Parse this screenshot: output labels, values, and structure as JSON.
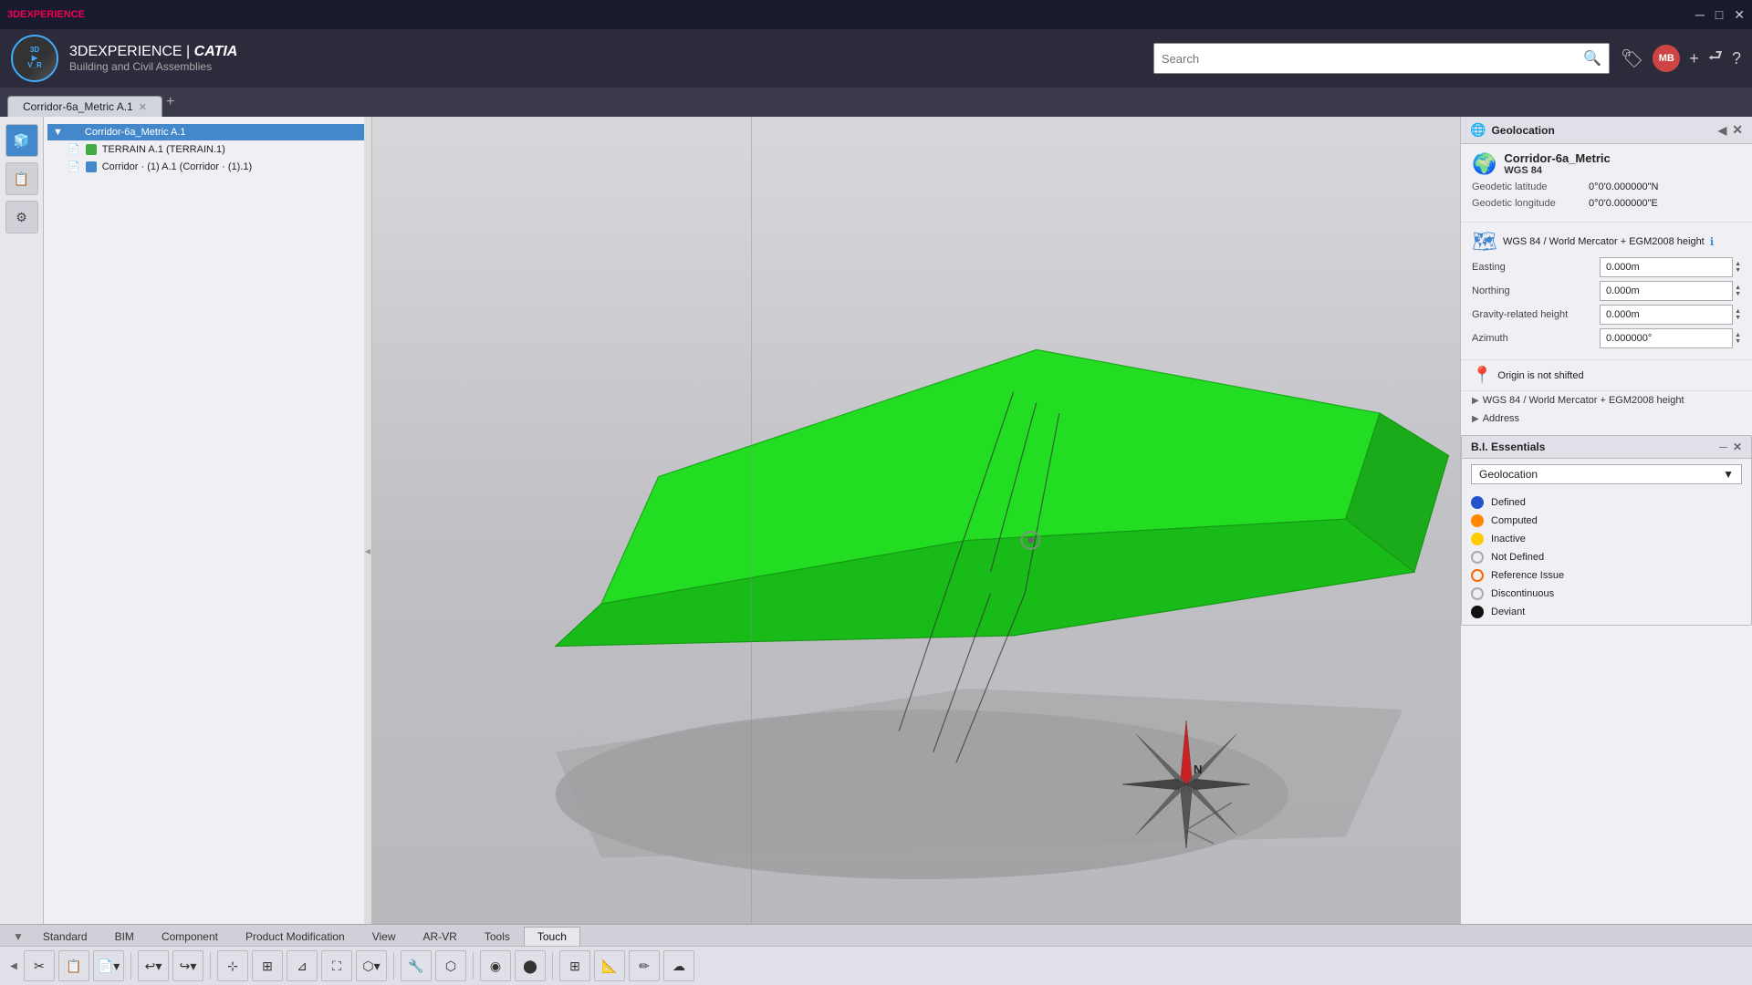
{
  "titlebar": {
    "app_name": "3DEXPERIENCE",
    "min_btn": "─",
    "max_btn": "□",
    "close_btn": "✕"
  },
  "header": {
    "logo_text": "3D\n▶\nV_R",
    "app_prefix": "3DEXPERIENCE",
    "separator": "|",
    "app_name": "CATIA",
    "app_subtitle": "Building and Civil Assemblies",
    "search_placeholder": "Search",
    "user_initials": "MB"
  },
  "tabs": [
    {
      "label": "Corridor-6a_Metric A.1",
      "active": true
    }
  ],
  "tree": {
    "items": [
      {
        "label": "Corridor-6a_Metric A.1",
        "level": 0,
        "selected": true,
        "color": "#4488cc"
      },
      {
        "label": "TERRAIN A.1 (TERRAIN.1)",
        "level": 1,
        "selected": false,
        "color": "#44aa44"
      },
      {
        "label": "Corridor · (1) A.1 (Corridor · (1).1)",
        "level": 1,
        "selected": false,
        "color": "#4488cc"
      }
    ]
  },
  "geolocation_panel": {
    "title": "Geolocation",
    "model_name": "Corridor-6a_Metric",
    "wgs84_label": "WGS 84",
    "geodetic_latitude_label": "Geodetic latitude",
    "geodetic_latitude_value": "0°0'0.000000\"N",
    "geodetic_longitude_label": "Geodetic longitude",
    "geodetic_longitude_value": "0°0'0.000000\"E",
    "crs_title": "WGS 84 / World Mercator + EGM2008 height",
    "easting_label": "Easting",
    "easting_value": "0.000m",
    "northing_label": "Northing",
    "northing_value": "0.000m",
    "gravity_height_label": "Gravity-related height",
    "gravity_height_value": "0.000m",
    "azimuth_label": "Azimuth",
    "azimuth_value": "0.000000°",
    "origin_text": "Origin is not shifted",
    "expand1_label": "▶ WGS 84 / World Mercator +  EGM2008 height",
    "expand2_label": "▶ Address"
  },
  "bi_essentials": {
    "title": "B.I. Essentials",
    "dropdown_value": "Geolocation",
    "legend": [
      {
        "key": "defined",
        "label": "Defined",
        "color": "#2255cc",
        "dot_style": "filled"
      },
      {
        "key": "computed",
        "label": "Computed",
        "color": "#ff8800",
        "dot_style": "filled"
      },
      {
        "key": "inactive",
        "label": "Inactive",
        "color": "#ffcc00",
        "dot_style": "filled"
      },
      {
        "key": "not_defined",
        "label": "Not Defined",
        "color": "#aaaaaa",
        "dot_style": "outline"
      },
      {
        "key": "reference",
        "label": "Reference Issue",
        "color": "#ff6600",
        "dot_style": "outline"
      },
      {
        "key": "discontinuous",
        "label": "Discontinuous",
        "color": "#aaaaaa",
        "dot_style": "outline"
      },
      {
        "key": "deviant",
        "label": "Deviant",
        "color": "#111111",
        "dot_style": "filled"
      }
    ]
  },
  "toolbar": {
    "tabs": [
      "Standard",
      "BIM",
      "Component",
      "Product Modification",
      "View",
      "AR-VR",
      "Tools",
      "Touch"
    ],
    "active_tab": "Touch"
  }
}
